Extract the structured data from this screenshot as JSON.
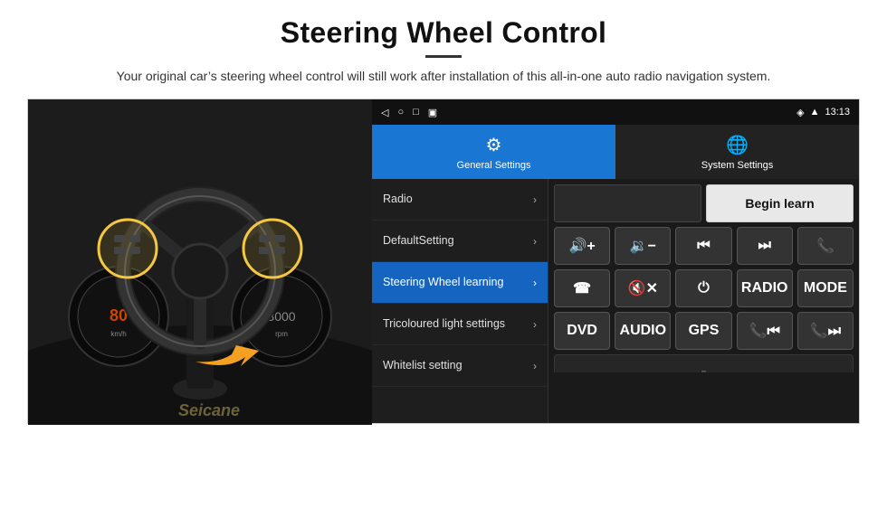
{
  "header": {
    "title": "Steering Wheel Control",
    "subtitle": "Your original car’s steering wheel control will still work after installation of this all-in-one auto radio navigation system."
  },
  "status_bar": {
    "time": "13:13",
    "icons": [
      "location",
      "signal",
      "wifi"
    ]
  },
  "tabs": [
    {
      "id": "general",
      "label": "General Settings",
      "icon": "⚙",
      "active": true
    },
    {
      "id": "system",
      "label": "System Settings",
      "icon": "🌐",
      "active": false
    }
  ],
  "menu_items": [
    {
      "id": "radio",
      "label": "Radio",
      "active": false
    },
    {
      "id": "default",
      "label": "DefaultSetting",
      "active": false
    },
    {
      "id": "steering",
      "label": "Steering Wheel learning",
      "active": true
    },
    {
      "id": "tricoloured",
      "label": "Tricoloured light settings",
      "active": false
    },
    {
      "id": "whitelist",
      "label": "Whitelist setting",
      "active": false
    }
  ],
  "controls": {
    "begin_learn_label": "Begin learn",
    "buttons_row1": [
      {
        "id": "vol-up",
        "symbol": "🔊+",
        "label": "Volume Up"
      },
      {
        "id": "vol-down",
        "symbol": "🔉−",
        "label": "Volume Down"
      },
      {
        "id": "prev",
        "symbol": "⏮",
        "label": "Previous"
      },
      {
        "id": "next",
        "symbol": "⏭",
        "label": "Next"
      },
      {
        "id": "phone",
        "symbol": "📞",
        "label": "Phone"
      }
    ],
    "buttons_row2": [
      {
        "id": "hang-up",
        "symbol": "📵",
        "label": "Hang Up"
      },
      {
        "id": "mute",
        "symbol": "🔇",
        "label": "Mute"
      },
      {
        "id": "power",
        "symbol": "⏻",
        "label": "Power"
      },
      {
        "id": "radio-btn",
        "symbol": "RADIO",
        "label": "Radio"
      },
      {
        "id": "mode",
        "symbol": "MODE",
        "label": "Mode"
      }
    ],
    "buttons_row3": [
      {
        "id": "dvd",
        "symbol": "DVD",
        "label": "DVD"
      },
      {
        "id": "audio",
        "symbol": "AUDIO",
        "label": "Audio"
      },
      {
        "id": "gps",
        "symbol": "GPS",
        "label": "GPS"
      },
      {
        "id": "tel-prev",
        "symbol": "📞⏮",
        "label": "Tel Prev"
      },
      {
        "id": "tel-next",
        "symbol": "📞⏭",
        "label": "Tel Next"
      }
    ]
  },
  "watermark": "Seicane"
}
